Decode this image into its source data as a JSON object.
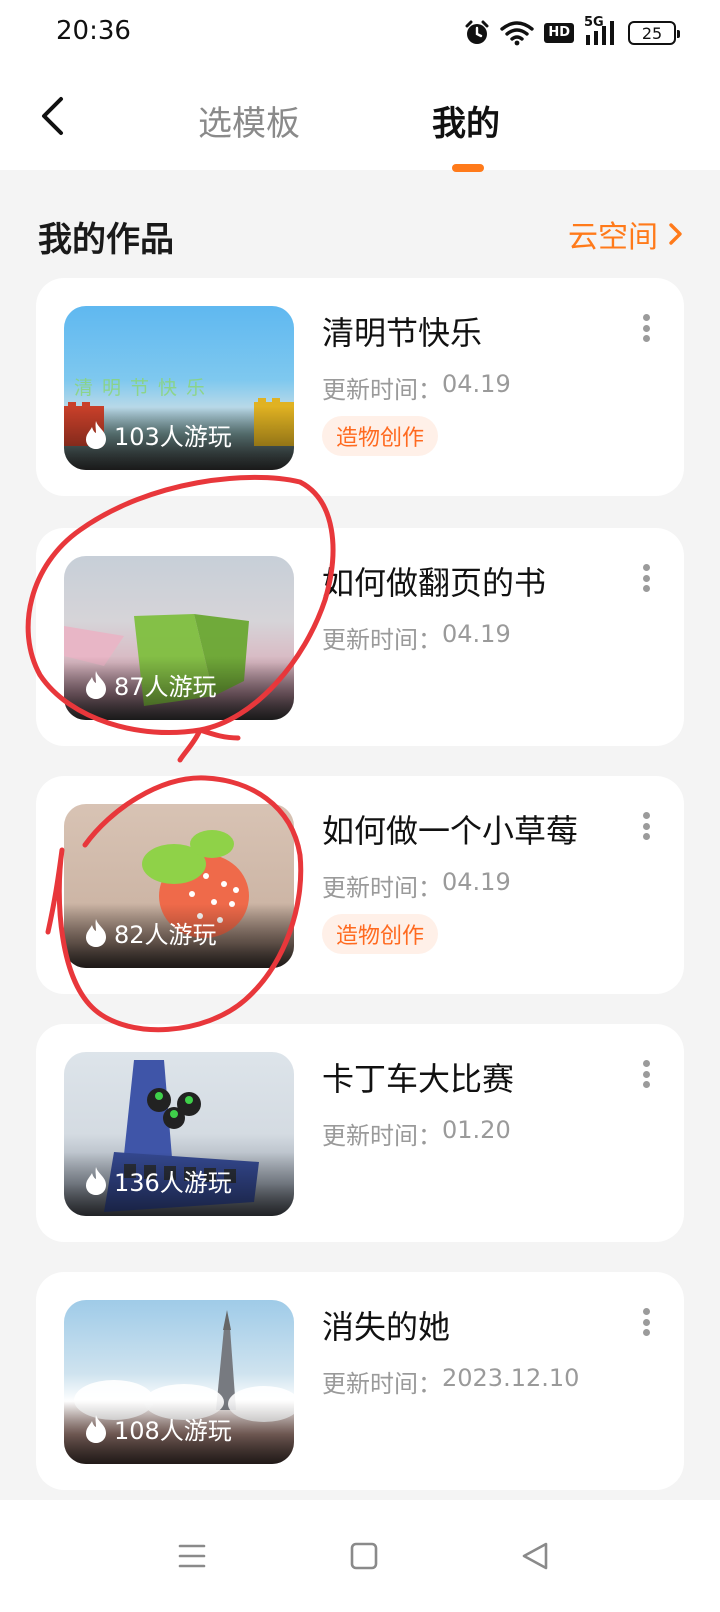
{
  "status_bar": {
    "time": "20:36",
    "network": "5G",
    "hd": "HD",
    "battery": "25"
  },
  "header": {
    "tabs": [
      {
        "label": "选模板",
        "active": false
      },
      {
        "label": "我的",
        "active": true
      }
    ],
    "accent_color": "#ff7a1a"
  },
  "section": {
    "title": "我的作品",
    "cloud_link": "云空间"
  },
  "works": [
    {
      "title": "清明节快乐",
      "updated_label": "更新时间：",
      "updated": "04.19",
      "plays": "103人游玩",
      "tag": "造物创作"
    },
    {
      "title": "如何做翻页的书",
      "updated_label": "更新时间：",
      "updated": "04.19",
      "plays": "87人游玩",
      "tag": ""
    },
    {
      "title": "如何做一个小草莓",
      "updated_label": "更新时间：",
      "updated": "04.19",
      "plays": "82人游玩",
      "tag": "造物创作"
    },
    {
      "title": "卡丁车大比赛",
      "updated_label": "更新时间：",
      "updated": "01.20",
      "plays": "136人游玩",
      "tag": ""
    },
    {
      "title": "消失的她",
      "updated_label": "更新时间：",
      "updated": "2023.12.10",
      "plays": "108人游玩",
      "tag": ""
    }
  ],
  "thumb_text": "清明节快乐"
}
